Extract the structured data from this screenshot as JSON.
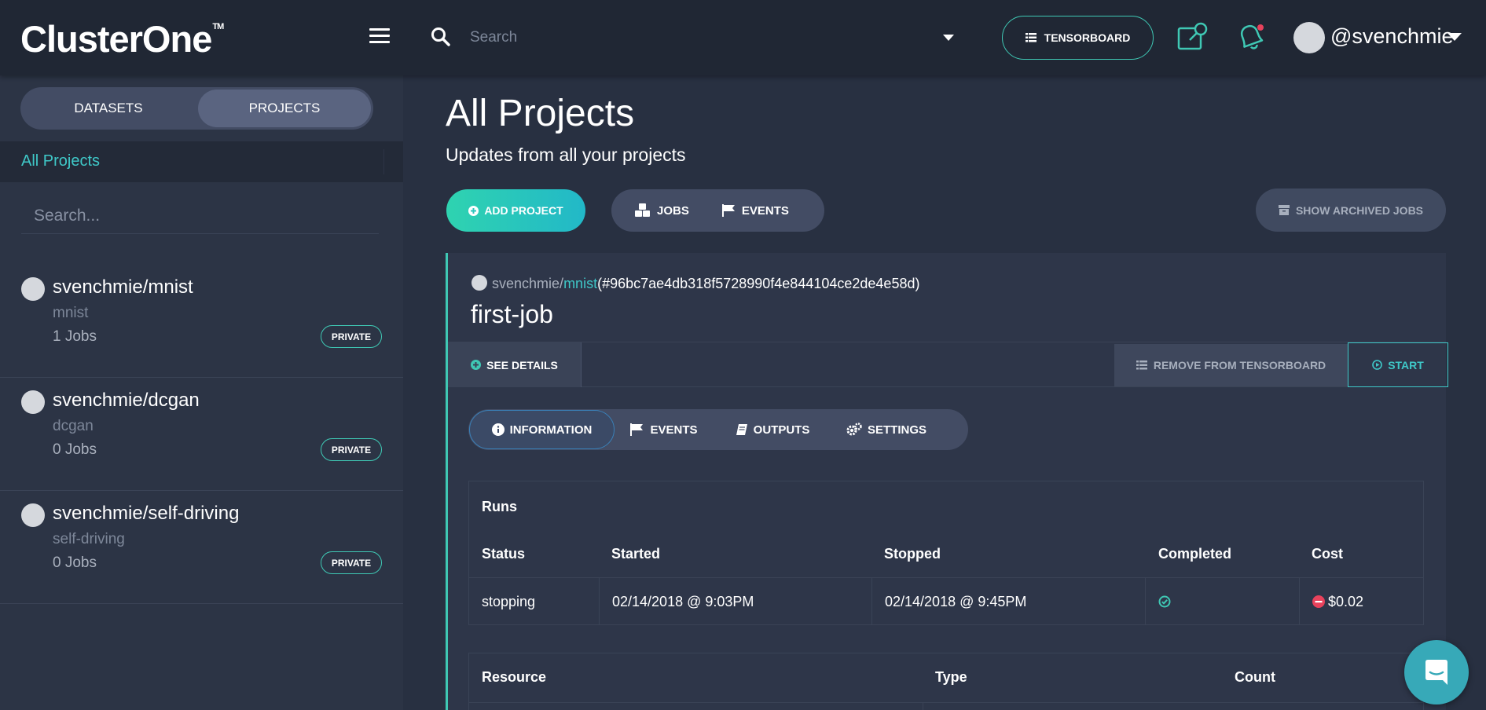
{
  "header": {
    "logo": "ClusterOne",
    "logo_tm": "TM",
    "search_placeholder": "Search",
    "tensorboard_label": "TENSORBOARD",
    "username": "@svenchmie"
  },
  "sidebar": {
    "tab_datasets": "DATASETS",
    "tab_projects": "PROJECTS",
    "all_projects": "All Projects",
    "search_placeholder": "Search...",
    "projects": [
      {
        "name": "svenchmie/mnist",
        "sub": "mnist",
        "jobs": "1 Jobs",
        "badge": "PRIVATE"
      },
      {
        "name": "svenchmie/dcgan",
        "sub": "dcgan",
        "jobs": "0 Jobs",
        "badge": "PRIVATE"
      },
      {
        "name": "svenchmie/self-driving",
        "sub": "self-driving",
        "jobs": "0 Jobs",
        "badge": "PRIVATE"
      }
    ]
  },
  "main": {
    "title": "All Projects",
    "subtitle": "Updates from all your projects",
    "add_project": "ADD PROJECT",
    "jobs": "JOBS",
    "events": "EVENTS",
    "show_archived": "SHOW ARCHIVED JOBS",
    "job": {
      "owner": "svenchmie",
      "slash": "/",
      "repo": "mnist",
      "hash": "(#96bc7ae4db318f5728990f4e844104ce2de4e58d)",
      "title": "first-job",
      "see_details": "SEE DETAILS",
      "remove_tensorboard": "REMOVE FROM TENSORBOARD",
      "start": "START",
      "tabs": {
        "information": "INFORMATION",
        "events": "EVENTS",
        "outputs": "OUTPUTS",
        "settings": "SETTINGS"
      },
      "runs": {
        "title": "Runs",
        "headers": [
          "Status",
          "Started",
          "Stopped",
          "Completed",
          "Cost"
        ],
        "row": {
          "status": "stopping",
          "started": "02/14/2018 @ 9:03PM",
          "stopped": "02/14/2018 @ 9:45PM",
          "cost": "$0.02"
        }
      },
      "resources": {
        "headers": [
          "Resource",
          "Type",
          "Count"
        ]
      }
    }
  },
  "colors": {
    "accent": "#3fc8b4",
    "link": "#3fc8c8",
    "background": "#283041",
    "topbar": "#202734",
    "danger": "#e8425c"
  }
}
